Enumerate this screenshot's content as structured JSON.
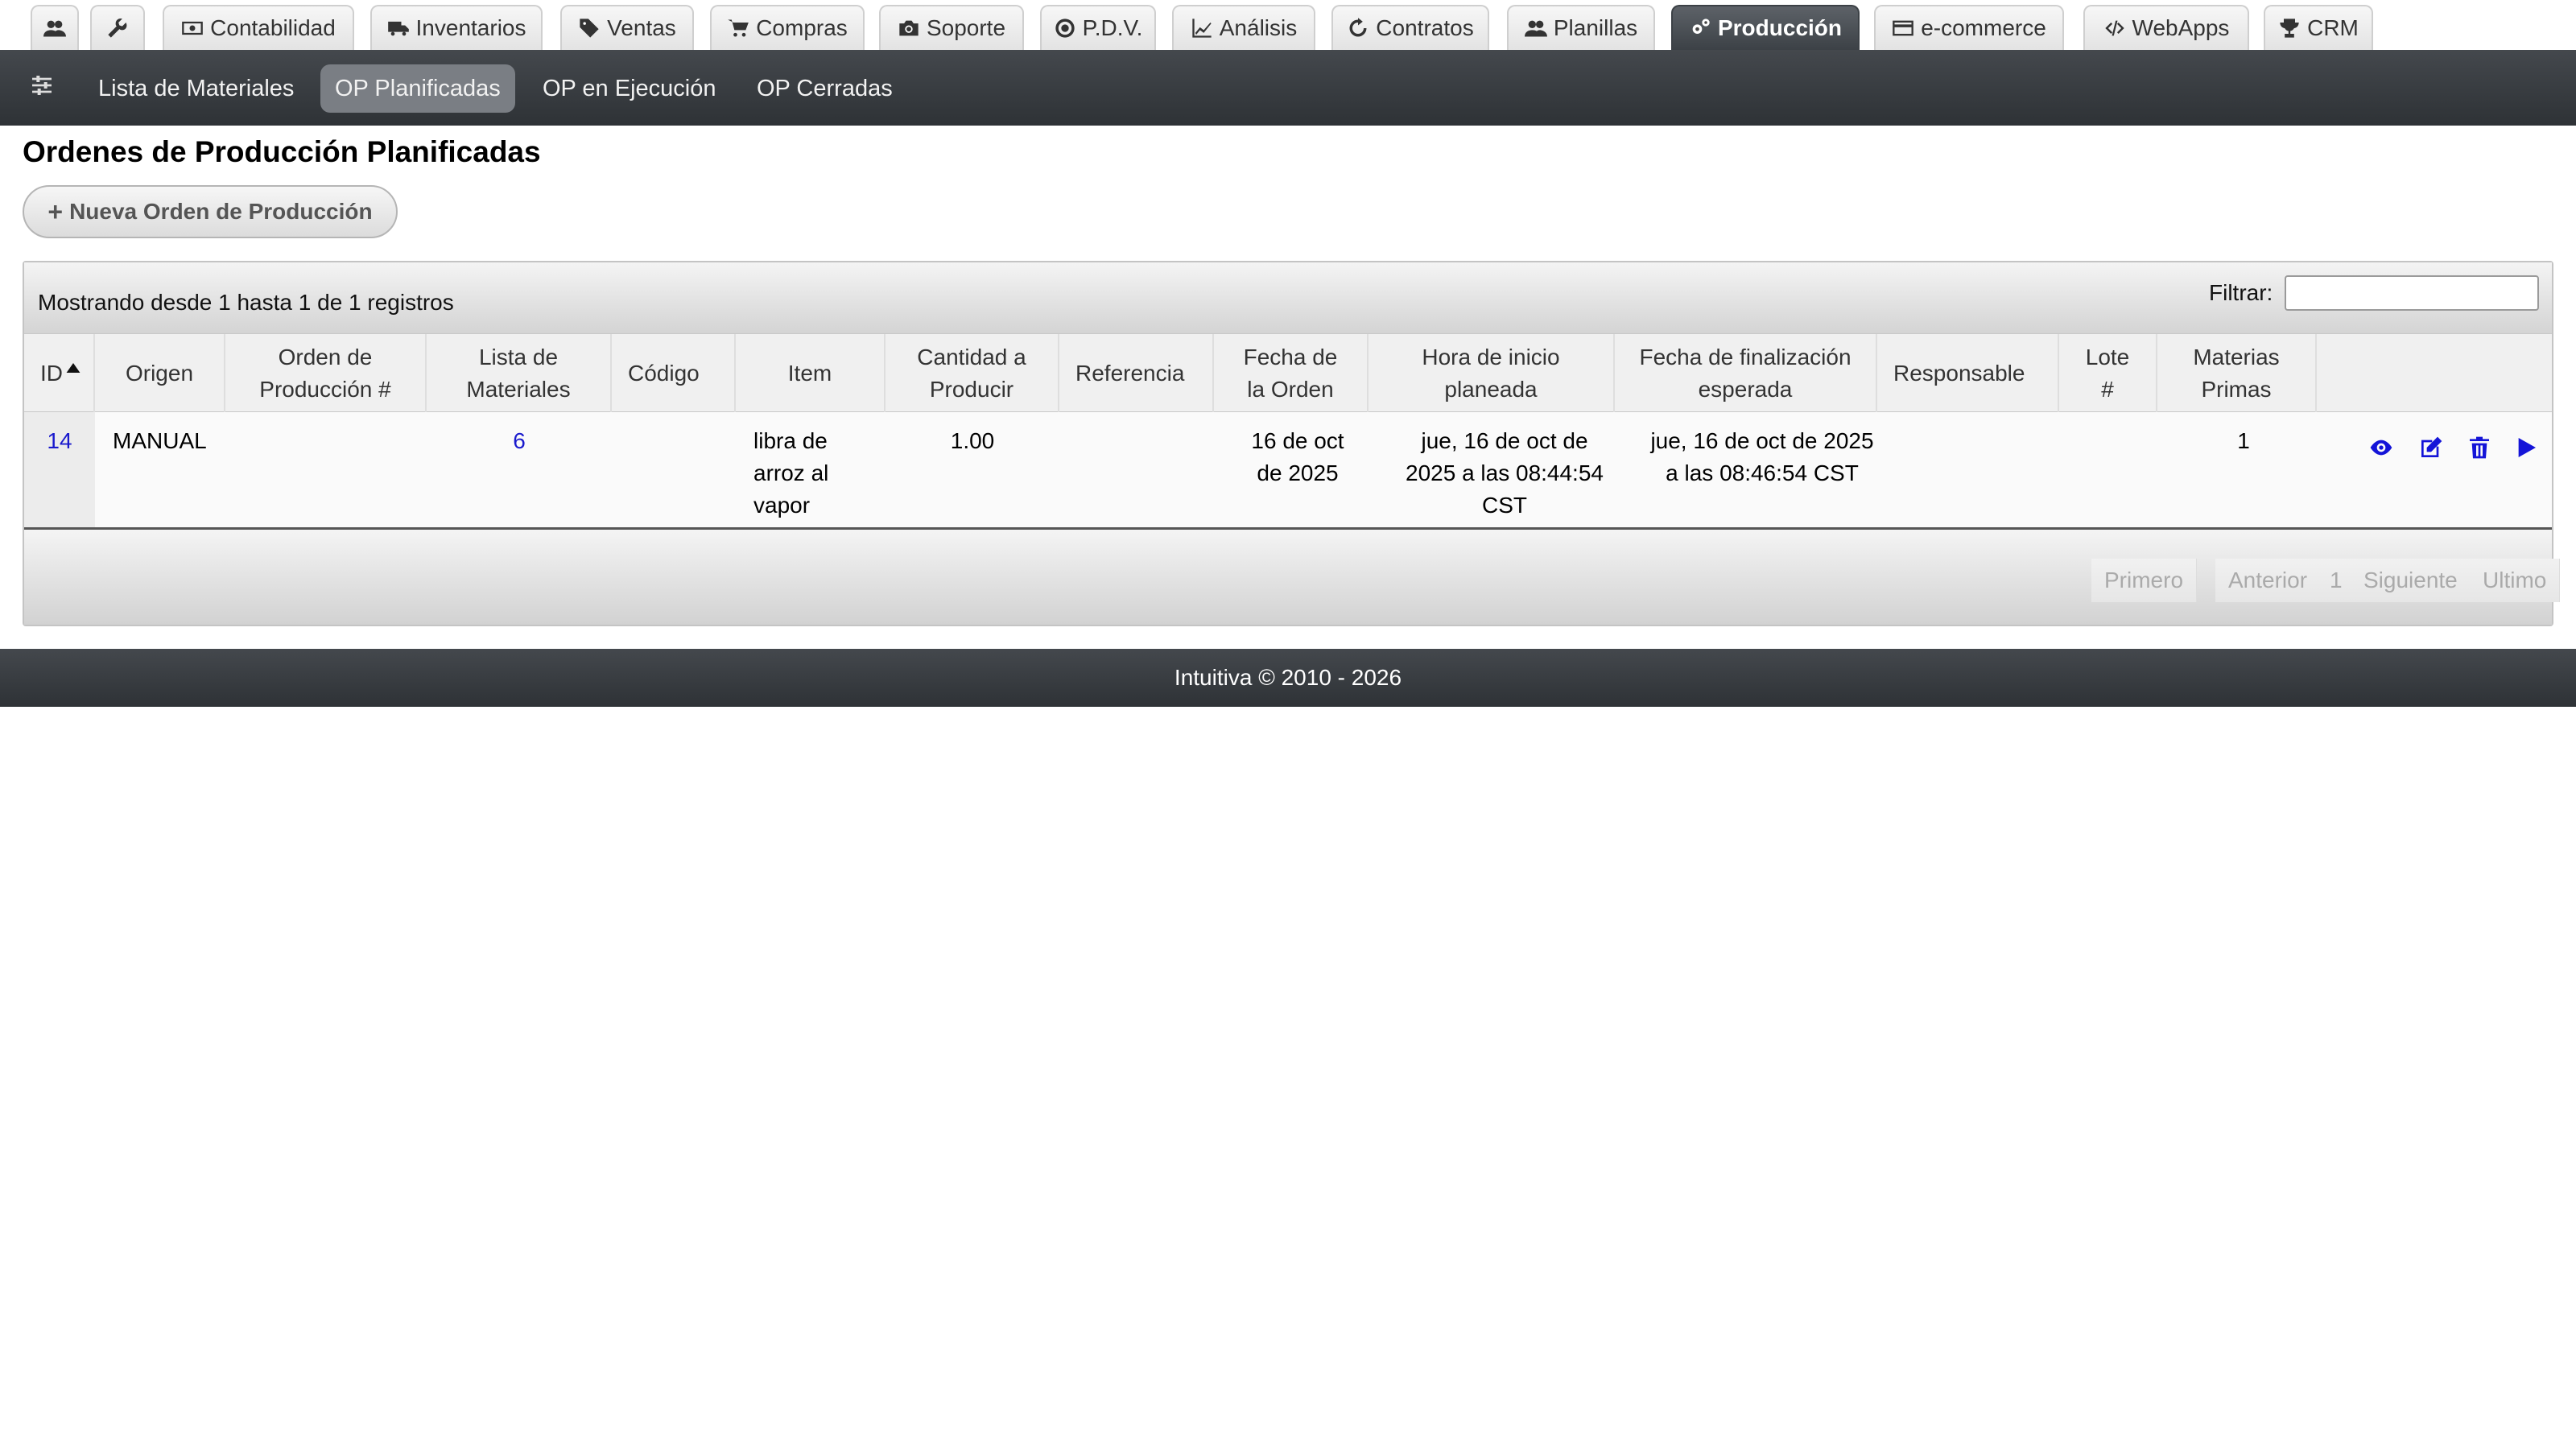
{
  "top_tabs": [
    {
      "label": "",
      "icon": "users-icon"
    },
    {
      "label": "",
      "icon": "wrench-icon"
    },
    {
      "label": "Contabilidad",
      "icon": "money-icon"
    },
    {
      "label": "Inventarios",
      "icon": "truck-icon"
    },
    {
      "label": "Ventas",
      "icon": "tags-icon"
    },
    {
      "label": "Compras",
      "icon": "cart-icon"
    },
    {
      "label": "Soporte",
      "icon": "camera-icon"
    },
    {
      "label": "P.D.V.",
      "icon": "target-icon"
    },
    {
      "label": "Análisis",
      "icon": "chart-line-icon"
    },
    {
      "label": "Contratos",
      "icon": "refresh-icon"
    },
    {
      "label": "Planillas",
      "icon": "users-icon"
    },
    {
      "label": "Producción",
      "icon": "gears-icon",
      "active": true
    },
    {
      "label": "e-commerce",
      "icon": "credit-card-icon"
    },
    {
      "label": "WebApps",
      "icon": "code-icon"
    },
    {
      "label": "CRM",
      "icon": "trophy-icon"
    }
  ],
  "subnav": {
    "items": [
      {
        "label": "Lista de Materiales"
      },
      {
        "label": "OP Planificadas",
        "active": true
      },
      {
        "label": "OP en Ejecución"
      },
      {
        "label": "OP Cerradas"
      }
    ]
  },
  "page": {
    "title": "Ordenes de Producción Planificadas",
    "new_button": "Nueva Orden de Producción"
  },
  "table": {
    "info": "Mostrando desde 1 hasta 1 de 1 registros",
    "filter_label": "Filtrar:",
    "filter_value": "",
    "columns": [
      "ID",
      "Origen",
      "Orden de\nProducción #",
      "Lista de\nMateriales",
      "Código",
      "Item",
      "Cantidad a\nProducir",
      "Referencia",
      "Fecha de\nla Orden",
      "Hora de inicio\nplaneada",
      "Fecha de finalización\nesperada",
      "Responsable",
      "Lote\n#",
      "Materias\nPrimas",
      ""
    ],
    "rows": [
      {
        "id": "14",
        "origen": "MANUAL",
        "orden": "",
        "lista": "6",
        "codigo": "",
        "item": "libra de\narroz al\nvapor",
        "cantidad": "1.00",
        "referencia": "",
        "fecha_orden": "16 de oct\nde 2025",
        "hora_inicio": "jue, 16 de oct de\n2025 a las 08:44:54\nCST",
        "fecha_fin": "jue, 16 de oct de 2025\na las 08:46:54 CST",
        "responsable": "",
        "lote": "",
        "materias": "1",
        "actions": [
          "eye-icon",
          "edit-icon",
          "trash-icon",
          "play-icon"
        ]
      }
    ],
    "pagination": [
      "Primero",
      "Anterior",
      "1",
      "Siguiente",
      "Ultimo"
    ]
  },
  "footer": {
    "text": "Intuitiva © 2010 - 2026"
  },
  "colors": {
    "accent_dark": "#3c4146",
    "link": "#1a1acd",
    "active_subnav": "#7a7e84"
  }
}
